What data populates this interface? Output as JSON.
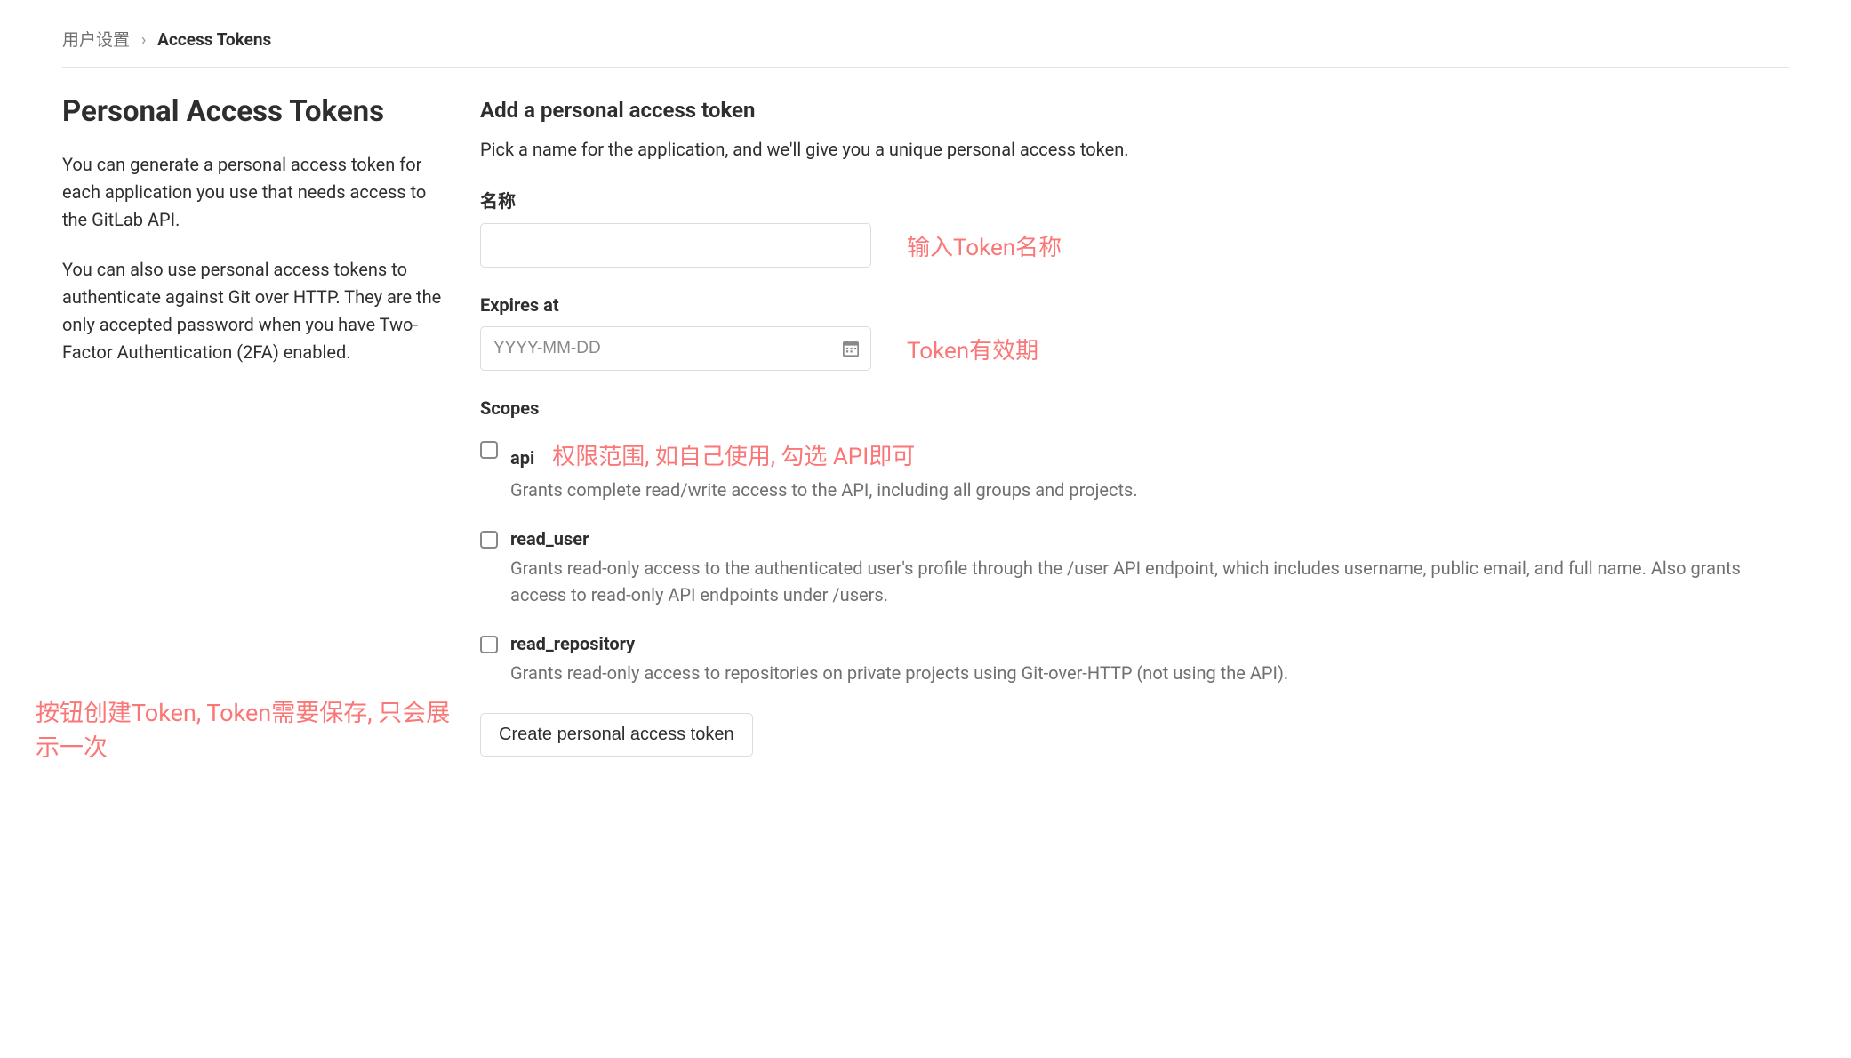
{
  "breadcrumb": {
    "parent": "用户设置",
    "separator": "›",
    "current": "Access Tokens"
  },
  "sidebar": {
    "title": "Personal Access Tokens",
    "para1": "You can generate a personal access token for each application you use that needs access to the GitLab API.",
    "para2": "You can also use personal access tokens to authenticate against Git over HTTP. They are the only accepted password when you have Two-Factor Authentication (2FA) enabled."
  },
  "form": {
    "title": "Add a personal access token",
    "desc": "Pick a name for the application, and we'll give you a unique personal access token.",
    "nameLabel": "名称",
    "nameValue": "",
    "expiresLabel": "Expires at",
    "expiresPlaceholder": "YYYY-MM-DD",
    "expiresValue": "",
    "scopesLabel": "Scopes",
    "scopes": [
      {
        "key": "api",
        "label": "api",
        "desc": "Grants complete read/write access to the API, including all groups and projects."
      },
      {
        "key": "read_user",
        "label": "read_user",
        "desc": "Grants read-only access to the authenticated user's profile through the /user API endpoint, which includes username, public email, and full name. Also grants access to read-only API endpoints under /users."
      },
      {
        "key": "read_repository",
        "label": "read_repository",
        "desc": "Grants read-only access to repositories on private projects using Git-over-HTTP (not using the API)."
      }
    ],
    "submitLabel": "Create personal access token"
  },
  "annotations": {
    "nameHint": "输入Token名称",
    "expiresHint": "Token有效期",
    "scopesHint": "权限范围, 如自己使用, 勾选 API即可",
    "submitHint": "按钮创建Token, Token需要保存, 只会展示一次"
  }
}
